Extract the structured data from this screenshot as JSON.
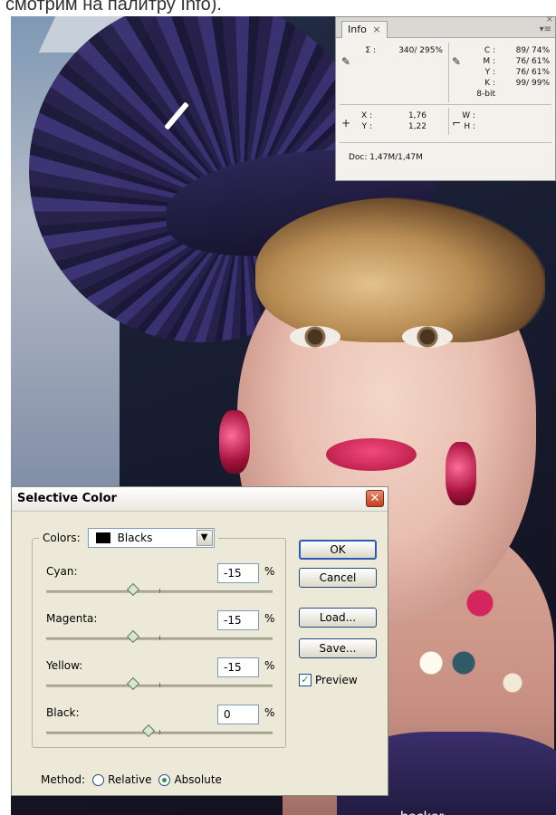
{
  "caption": "смотрим на палитру Info).",
  "photo": {
    "credit": "hecker"
  },
  "info_panel": {
    "tab_label": "Info",
    "close_glyph": "×",
    "window_close_glyph": "×",
    "menu_glyph": "▾≡",
    "sum_label": "Σ :",
    "sum_value": "340/ 295%",
    "cmyk": [
      {
        "label": "C :",
        "value": "89/  74%"
      },
      {
        "label": "M :",
        "value": "76/  61%"
      },
      {
        "label": "Y :",
        "value": "76/  61%"
      },
      {
        "label": "K :",
        "value": "99/  99%"
      }
    ],
    "bit_depth": "8-bit",
    "x_label": "X :",
    "x_value": "1,76",
    "y_label": "Y :",
    "y_value": "1,22",
    "w_label": "W :",
    "h_label": "H :",
    "doc": "Doc: 1,47M/1,47M"
  },
  "dialog": {
    "title": "Selective Color",
    "close_glyph": "✕",
    "colors_label": "Colors:",
    "colors_value": "Blacks",
    "channels": [
      {
        "label": "Cyan:",
        "value": "-15",
        "unit": "%",
        "level": -15
      },
      {
        "label": "Magenta:",
        "value": "-15",
        "unit": "%",
        "level": -15
      },
      {
        "label": "Yellow:",
        "value": "-15",
        "unit": "%",
        "level": -15
      },
      {
        "label": "Black:",
        "value": "0",
        "unit": "%",
        "level": 0
      }
    ],
    "buttons": {
      "ok": "OK",
      "cancel": "Cancel",
      "load": "Load...",
      "save": "Save..."
    },
    "preview_label": "Preview",
    "preview_checked": true,
    "method_label": "Method:",
    "method_options": [
      "Relative",
      "Absolute"
    ],
    "method_selected": "Absolute",
    "accent_color": "#2a9d3a",
    "close_color": "#c4401d"
  }
}
